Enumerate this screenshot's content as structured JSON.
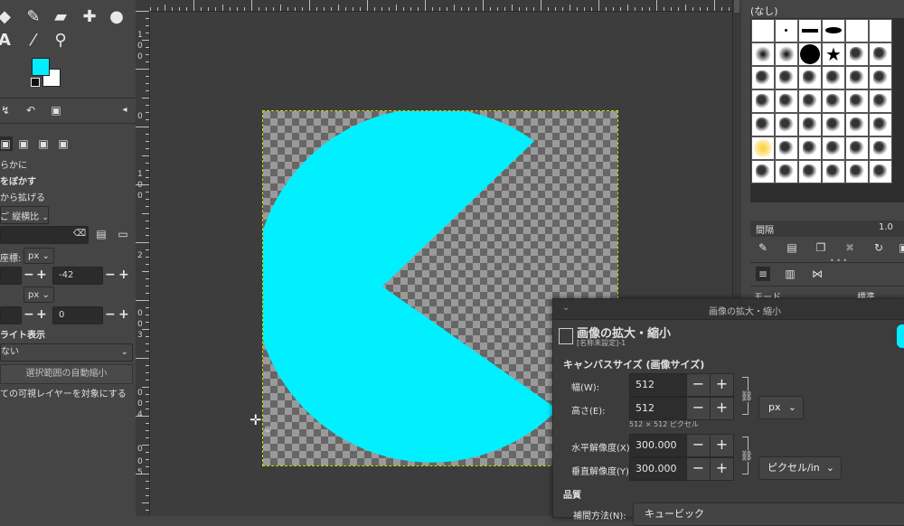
{
  "colors": {
    "foreground": "#00eeff",
    "background": "#ffffff",
    "pacman": "#00f0ff",
    "dialog_bg": "#3c3c3c"
  },
  "tool_options": {
    "antialias_suffix": "らかに",
    "feather_label": "をぼかす",
    "expand_label": "から拡げる",
    "fixed_label": "縦横比",
    "position_label": "座標:",
    "unit1": "px",
    "pos_x": "",
    "pos_y": "-42",
    "unit2": "px",
    "size_w": "",
    "size_h": "0",
    "highlight_label": "ライト表示",
    "guides_value": "ない",
    "auto_shrink_label": "選択範囲の自動縮小",
    "visible_layers_label": "ての可視レイヤーを対象にする"
  },
  "rulers": {
    "left_labels": [
      "1",
      "0",
      "0",
      "0",
      "1",
      "0",
      "0",
      "2",
      "0",
      "0",
      "3",
      "0",
      "0",
      "4",
      "0",
      "0",
      "5",
      "0",
      "0"
    ]
  },
  "right_dock": {
    "brush_name": "(なし)",
    "spacing_label": "間隔",
    "spacing_value": "1.0",
    "mode_label": "モード",
    "mode_value": "標準"
  },
  "dialog": {
    "window_title": "画像の拡大・縮小",
    "heading": "画像の拡大・縮小",
    "subheading": "[名称未設定]-1",
    "section_size": "キャンバスサイズ (画像サイズ)",
    "width_label": "幅(W):",
    "width_value": "512",
    "height_label": "高さ(E):",
    "height_value": "512",
    "size_unit": "px",
    "pixel_info": "512 × 512 ピクセル",
    "xres_label": "水平解像度(X):",
    "xres_value": "300.000",
    "yres_label": "垂直解像度(Y):",
    "yres_value": "300.000",
    "res_unit": "ピクセル/in",
    "quality_label": "品質",
    "interp_label": "補間方法(N):",
    "interp_value": "キュービック"
  }
}
